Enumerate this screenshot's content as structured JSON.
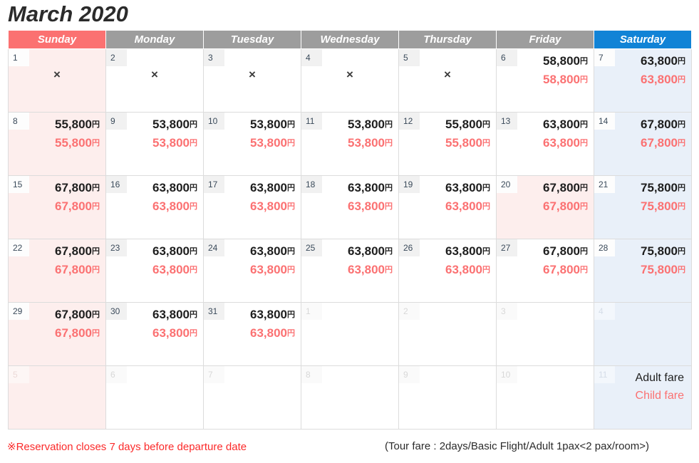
{
  "title": "March 2020",
  "currency_suffix": "円",
  "unavailable_mark": "×",
  "colors": {
    "sunday_header": "#fb7171",
    "weekday_header": "#9d9d9d",
    "saturday_header": "#1183d6",
    "sunday_cell": "#fdeeed",
    "saturday_cell": "#e9f0f9",
    "adult_price": "#1e1e1e",
    "child_price": "#fb7172",
    "notice": "#fb2a2a"
  },
  "weekdays": [
    {
      "label": "Sunday",
      "kind": "sun"
    },
    {
      "label": "Monday",
      "kind": "weekday"
    },
    {
      "label": "Tuesday",
      "kind": "weekday"
    },
    {
      "label": "Wednesday",
      "kind": "weekday"
    },
    {
      "label": "Thursday",
      "kind": "weekday"
    },
    {
      "label": "Friday",
      "kind": "weekday"
    },
    {
      "label": "Saturday",
      "kind": "sat"
    }
  ],
  "legend": {
    "adult_label": "Adult fare",
    "child_label": "Child fare"
  },
  "footer": {
    "notice": "※Reservation closes 7 days before departure date",
    "tour_fare": "(Tour fare : 2days/Basic Flight/Adult 1pax<2 pax/room>)"
  },
  "weeks": [
    [
      {
        "day": "1",
        "adult": "",
        "child": "",
        "unavailable": true,
        "out": false
      },
      {
        "day": "2",
        "adult": "",
        "child": "",
        "unavailable": true,
        "out": false
      },
      {
        "day": "3",
        "adult": "",
        "child": "",
        "unavailable": true,
        "out": false
      },
      {
        "day": "4",
        "adult": "",
        "child": "",
        "unavailable": true,
        "out": false
      },
      {
        "day": "5",
        "adult": "",
        "child": "",
        "unavailable": true,
        "out": false
      },
      {
        "day": "6",
        "adult": "58,800",
        "child": "58,800",
        "unavailable": false,
        "out": false
      },
      {
        "day": "7",
        "adult": "63,800",
        "child": "63,800",
        "unavailable": false,
        "out": false
      }
    ],
    [
      {
        "day": "8",
        "adult": "55,800",
        "child": "55,800",
        "unavailable": false,
        "out": false
      },
      {
        "day": "9",
        "adult": "53,800",
        "child": "53,800",
        "unavailable": false,
        "out": false
      },
      {
        "day": "10",
        "adult": "53,800",
        "child": "53,800",
        "unavailable": false,
        "out": false
      },
      {
        "day": "11",
        "adult": "53,800",
        "child": "53,800",
        "unavailable": false,
        "out": false
      },
      {
        "day": "12",
        "adult": "55,800",
        "child": "55,800",
        "unavailable": false,
        "out": false
      },
      {
        "day": "13",
        "adult": "63,800",
        "child": "63,800",
        "unavailable": false,
        "out": false
      },
      {
        "day": "14",
        "adult": "67,800",
        "child": "67,800",
        "unavailable": false,
        "out": false
      }
    ],
    [
      {
        "day": "15",
        "adult": "67,800",
        "child": "67,800",
        "unavailable": false,
        "out": false
      },
      {
        "day": "16",
        "adult": "63,800",
        "child": "63,800",
        "unavailable": false,
        "out": false
      },
      {
        "day": "17",
        "adult": "63,800",
        "child": "63,800",
        "unavailable": false,
        "out": false
      },
      {
        "day": "18",
        "adult": "63,800",
        "child": "63,800",
        "unavailable": false,
        "out": false
      },
      {
        "day": "19",
        "adult": "63,800",
        "child": "63,800",
        "unavailable": false,
        "out": false
      },
      {
        "day": "20",
        "adult": "67,800",
        "child": "67,800",
        "unavailable": false,
        "out": false,
        "holiday": true
      },
      {
        "day": "21",
        "adult": "75,800",
        "child": "75,800",
        "unavailable": false,
        "out": false
      }
    ],
    [
      {
        "day": "22",
        "adult": "67,800",
        "child": "67,800",
        "unavailable": false,
        "out": false
      },
      {
        "day": "23",
        "adult": "63,800",
        "child": "63,800",
        "unavailable": false,
        "out": false
      },
      {
        "day": "24",
        "adult": "63,800",
        "child": "63,800",
        "unavailable": false,
        "out": false
      },
      {
        "day": "25",
        "adult": "63,800",
        "child": "63,800",
        "unavailable": false,
        "out": false
      },
      {
        "day": "26",
        "adult": "63,800",
        "child": "63,800",
        "unavailable": false,
        "out": false
      },
      {
        "day": "27",
        "adult": "67,800",
        "child": "67,800",
        "unavailable": false,
        "out": false
      },
      {
        "day": "28",
        "adult": "75,800",
        "child": "75,800",
        "unavailable": false,
        "out": false
      }
    ],
    [
      {
        "day": "29",
        "adult": "67,800",
        "child": "67,800",
        "unavailable": false,
        "out": false
      },
      {
        "day": "30",
        "adult": "63,800",
        "child": "63,800",
        "unavailable": false,
        "out": false
      },
      {
        "day": "31",
        "adult": "63,800",
        "child": "63,800",
        "unavailable": false,
        "out": false
      },
      {
        "day": "1",
        "adult": "",
        "child": "",
        "unavailable": false,
        "out": true
      },
      {
        "day": "2",
        "adult": "",
        "child": "",
        "unavailable": false,
        "out": true
      },
      {
        "day": "3",
        "adult": "",
        "child": "",
        "unavailable": false,
        "out": true
      },
      {
        "day": "4",
        "adult": "",
        "child": "",
        "unavailable": false,
        "out": true
      }
    ],
    [
      {
        "day": "5",
        "adult": "",
        "child": "",
        "unavailable": false,
        "out": true
      },
      {
        "day": "6",
        "adult": "",
        "child": "",
        "unavailable": false,
        "out": true
      },
      {
        "day": "7",
        "adult": "",
        "child": "",
        "unavailable": false,
        "out": true
      },
      {
        "day": "8",
        "adult": "",
        "child": "",
        "unavailable": false,
        "out": true
      },
      {
        "day": "9",
        "adult": "",
        "child": "",
        "unavailable": false,
        "out": true
      },
      {
        "day": "10",
        "adult": "",
        "child": "",
        "unavailable": false,
        "out": true
      },
      {
        "day": "11",
        "adult": "",
        "child": "",
        "unavailable": false,
        "out": true,
        "legend": true
      }
    ]
  ]
}
